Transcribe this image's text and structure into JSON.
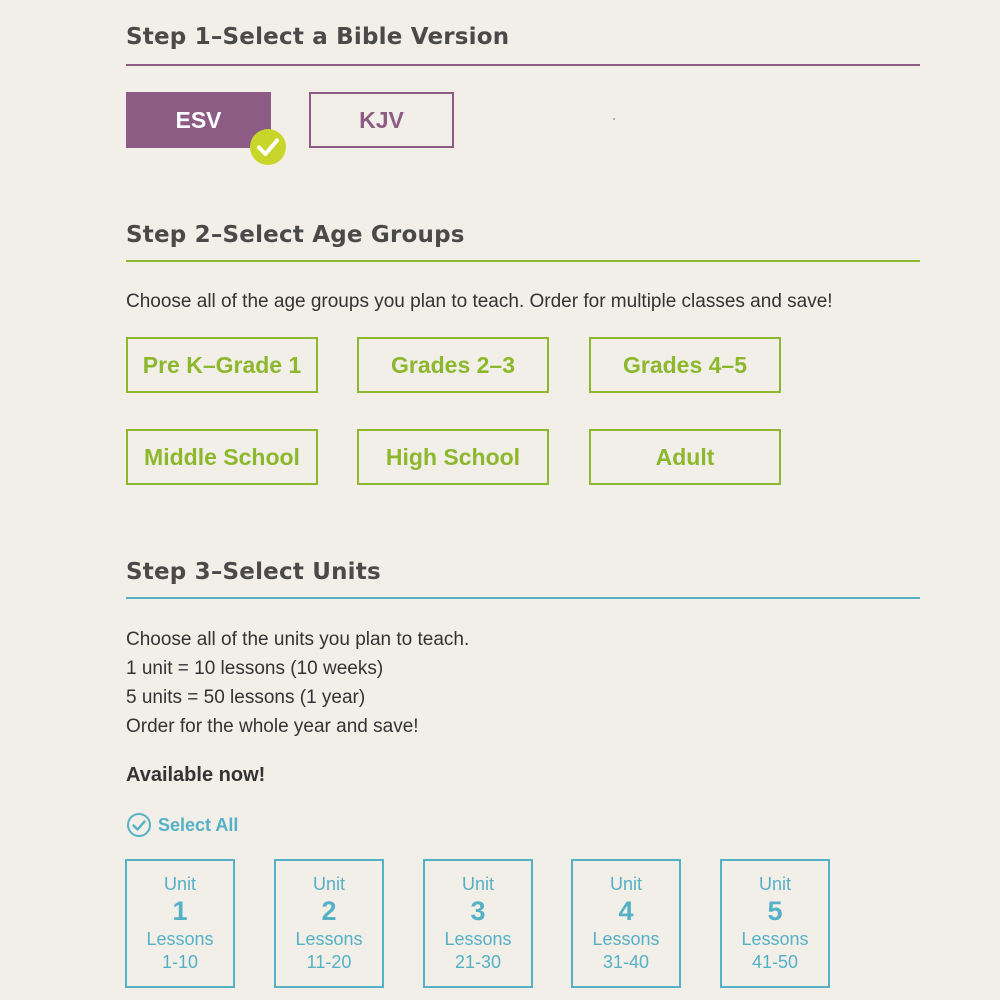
{
  "step1": {
    "title": "Step 1–Select a Bible Version",
    "accent": "#8c5c84",
    "versions": [
      {
        "label": "ESV",
        "selected": true
      },
      {
        "label": "KJV",
        "selected": false
      }
    ],
    "check_icon": "checkmark-badge-icon",
    "check_color": "#c8d62b"
  },
  "step2": {
    "title": "Step 2–Select Age Groups",
    "accent": "#8db82d",
    "description": "Choose all of the age groups you plan to teach. Order for multiple classes and save!",
    "age_groups": [
      {
        "label": "Pre K–Grade 1"
      },
      {
        "label": "Grades 2–3"
      },
      {
        "label": "Grades 4–5"
      },
      {
        "label": "Middle School"
      },
      {
        "label": "High School"
      },
      {
        "label": "Adult"
      }
    ]
  },
  "step3": {
    "title": "Step 3–Select Units",
    "accent": "#55b1c6",
    "description_lines": [
      "Choose all of the units you plan to teach.",
      "1 unit = 10 lessons (10 weeks)",
      "5 units = 50 lessons (1 year)",
      "Order for the whole year and save!"
    ],
    "available_label": "Available now!",
    "select_all_label": "Select All",
    "select_all_icon": "circle-check-icon",
    "units": [
      {
        "label": "Unit",
        "number": "1",
        "lessons_label": "Lessons",
        "range": "1-10"
      },
      {
        "label": "Unit",
        "number": "2",
        "lessons_label": "Lessons",
        "range": "11-20"
      },
      {
        "label": "Unit",
        "number": "3",
        "lessons_label": "Lessons",
        "range": "21-30"
      },
      {
        "label": "Unit",
        "number": "4",
        "lessons_label": "Lessons",
        "range": "31-40"
      },
      {
        "label": "Unit",
        "number": "5",
        "lessons_label": "Lessons",
        "range": "41-50"
      }
    ]
  }
}
